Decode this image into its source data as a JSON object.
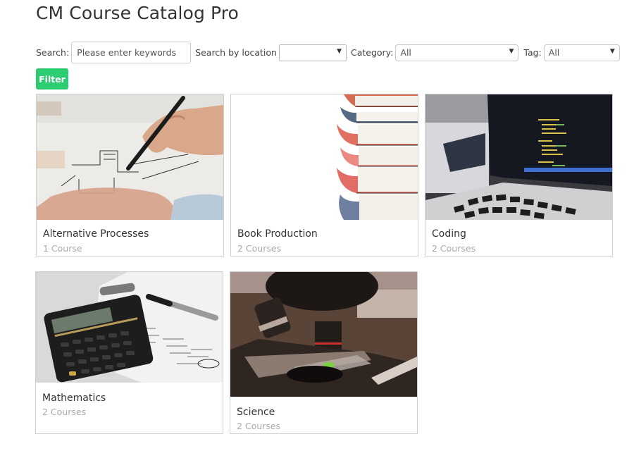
{
  "page": {
    "title": "CM Course Catalog Pro"
  },
  "filters": {
    "search_label": "Search:",
    "search_placeholder": "Please enter keywords",
    "search_value": "",
    "location_label": "Search by location",
    "location_value": "",
    "category_label": "Category:",
    "category_value": "All",
    "tag_label": "Tag:",
    "tag_value": "All",
    "dropdown_icon": "▼",
    "filter_button": "Filter"
  },
  "colors": {
    "filter_button": "#2ecc71",
    "count_text": "#aaaaaa",
    "card_border": "#cfcfcf"
  },
  "categories": [
    {
      "name": "Alternative Processes",
      "count": "1 Course",
      "image": "architect-drawing-sketch"
    },
    {
      "name": "Book Production",
      "count": "2 Courses",
      "image": "stack-of-books"
    },
    {
      "name": "Coding",
      "count": "2 Courses",
      "image": "laptop-with-code"
    },
    {
      "name": "Mathematics",
      "count": "2 Courses",
      "image": "calculator-and-pen"
    },
    {
      "name": "Science",
      "count": "2 Courses",
      "image": "microscope"
    }
  ]
}
